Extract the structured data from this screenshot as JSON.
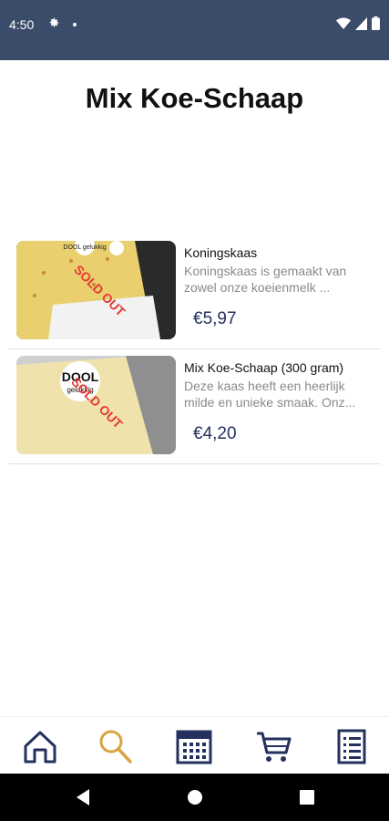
{
  "status_bar": {
    "time": "4:50",
    "icons": [
      "gear-icon",
      "notification-dot-icon",
      "wifi-icon",
      "signal-icon",
      "battery-icon"
    ],
    "background": "#3b4c6b"
  },
  "page": {
    "title": "Mix Koe-Schaap"
  },
  "products": [
    {
      "name": "Koningskaas",
      "description": "Koningskaas is gemaakt van zowel onze koeienmelk ...",
      "price": "€5,97",
      "badge": "SOLD OUT",
      "image_label": "DOOL gelukkig"
    },
    {
      "name": "Mix Koe-Schaap (300 gram)",
      "description": "Deze kaas heeft een heerlijk milde en unieke smaak. Onz...",
      "price": "€4,20",
      "badge": "SOLD OUT",
      "image_label_top": "DOOL",
      "image_label_bottom": "gelukkig"
    }
  ],
  "bottom_nav": {
    "items": [
      "home-icon",
      "search-icon",
      "calendar-icon",
      "cart-icon",
      "list-icon"
    ],
    "active": "search-icon",
    "active_color": "#d9a441",
    "icon_color": "#24315e"
  },
  "colors": {
    "price": "#24315e",
    "sold_out": "#e53935"
  }
}
